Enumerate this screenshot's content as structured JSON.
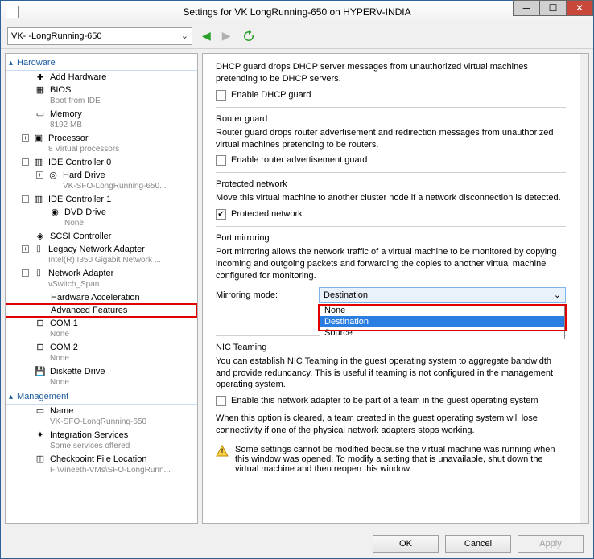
{
  "title": "Settings for VK       LongRunning-650 on HYPERV-INDIA",
  "vm_selected": "VK-     -LongRunning-650",
  "sections": {
    "hardware": "Hardware",
    "management": "Management"
  },
  "tree": {
    "add_hardware": "Add Hardware",
    "bios": "BIOS",
    "bios_sub": "Boot from IDE",
    "memory": "Memory",
    "memory_sub": "8192 MB",
    "processor": "Processor",
    "processor_sub": "8 Virtual processors",
    "ide0": "IDE Controller 0",
    "hard_drive": "Hard Drive",
    "hard_drive_sub": "VK-SFO-LongRunning-650...",
    "ide1": "IDE Controller 1",
    "dvd": "DVD Drive",
    "dvd_sub": "None",
    "scsi": "SCSI Controller",
    "legacy_na": "Legacy Network Adapter",
    "legacy_na_sub": "Intel(R) I350 Gigabit Network ...",
    "na": "Network Adapter",
    "na_sub": "vSwitch_Span",
    "hw_accel": "Hardware Acceleration",
    "adv_feat": "Advanced Features",
    "com1": "COM 1",
    "com1_sub": "None",
    "com2": "COM 2",
    "com2_sub": "None",
    "diskette": "Diskette Drive",
    "diskette_sub": "None",
    "name": "Name",
    "name_sub": "VK-SFO-LongRunning-650",
    "integ": "Integration Services",
    "integ_sub": "Some services offered",
    "checkpoint": "Checkpoint File Location",
    "checkpoint_sub": "F:\\Vineeth-VMs\\SFO-LongRunn..."
  },
  "right": {
    "dhcp_desc": "DHCP guard drops DHCP server messages from unauthorized virtual machines pretending to be DHCP servers.",
    "dhcp_check": "Enable DHCP guard",
    "router_title": "Router guard",
    "router_desc": "Router guard drops router advertisement and redirection messages from unauthorized virtual machines pretending to be routers.",
    "router_check": "Enable router advertisement guard",
    "protected_title": "Protected network",
    "protected_desc": "Move this virtual machine to another cluster node if a network disconnection is detected.",
    "protected_check": "Protected network",
    "mirror_title": "Port mirroring",
    "mirror_desc": "Port mirroring allows the network traffic of a virtual machine to be monitored by copying incoming and outgoing packets and forwarding the copies to another virtual machine configured for monitoring.",
    "mirror_label": "Mirroring mode:",
    "mirror_value": "Destination",
    "mirror_opts": [
      "None",
      "Destination",
      "Source"
    ],
    "nic_title": "NIC Teaming",
    "nic_desc": "You can establish NIC Teaming in the guest operating system to aggregate bandwidth and provide redundancy. This is useful if teaming is not configured in the management operating system.",
    "nic_check": "Enable this network adapter to be part of a team in the guest operating system",
    "nic_note": "When this option is cleared, a team created in the guest operating system will lose connectivity if one of the physical network adapters stops working.",
    "warning": "Some settings cannot be modified because the virtual machine was running when this window was opened. To modify a setting that is unavailable, shut down the virtual machine and then reopen this window."
  },
  "buttons": {
    "ok": "OK",
    "cancel": "Cancel",
    "apply": "Apply"
  }
}
